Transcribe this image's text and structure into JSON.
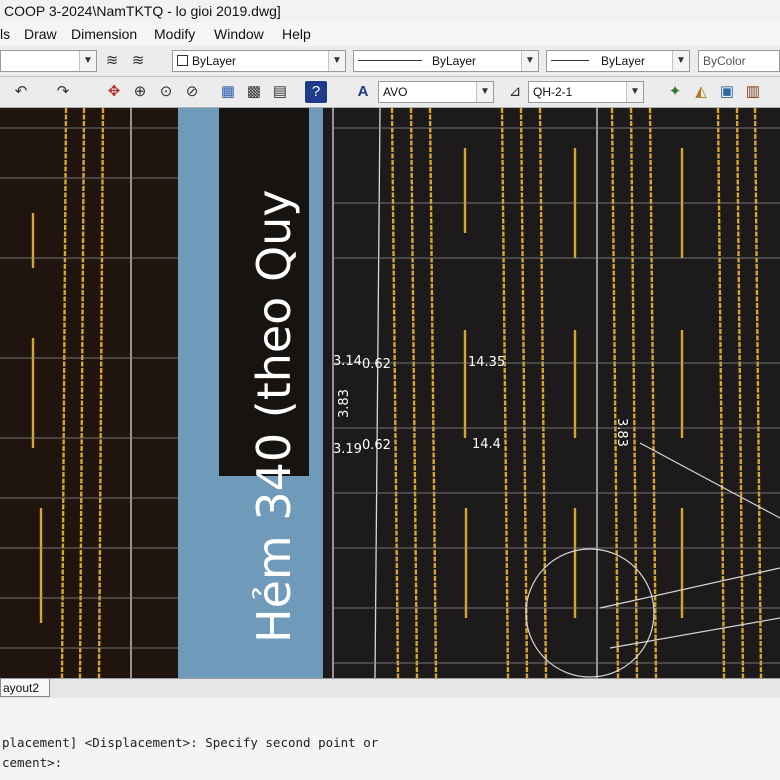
{
  "window": {
    "title": "COOP 3-2024\\NamTKTQ - lo gioi 2019.dwg]"
  },
  "menu": {
    "items": [
      "ls",
      "Draw",
      "Dimension",
      "Modify",
      "Window",
      "Help"
    ]
  },
  "properties_toolbar": {
    "layer_value": "",
    "color_value": "ByLayer",
    "linetype_value": "ByLayer",
    "lineweight_value": "ByLayer",
    "plotstyle_value": "ByColor"
  },
  "styles_toolbar": {
    "text_style": "AVO",
    "dim_style": "QH-2-1"
  },
  "icons": [
    "undo-icon",
    "redo-icon",
    "pan-icon",
    "zoom-realtime-icon",
    "zoom-window-icon",
    "zoom-previous-icon",
    "properties-icon",
    "design-center-icon",
    "tool-palettes-icon",
    "markup-icon",
    "help-icon",
    "text-style-icon",
    "dim-style-icon"
  ],
  "drawing": {
    "colors": {
      "background": "#20140e",
      "yellow": "#d6a431",
      "white": "#d8d8d8",
      "road": "#6f9ab9",
      "label_bg": "#161310"
    },
    "road_label": "Hẻm 340 (theo Quy",
    "dimensions": [
      "3.14",
      "0.62",
      "14.35",
      "3.83",
      "3.19",
      "0.62",
      "14.4",
      "3.83"
    ]
  },
  "layout_tabs": {
    "active": "ayout2"
  },
  "command_line": {
    "line1": "placement] <Displacement>: Specify second point or",
    "line2": "cement>:"
  }
}
